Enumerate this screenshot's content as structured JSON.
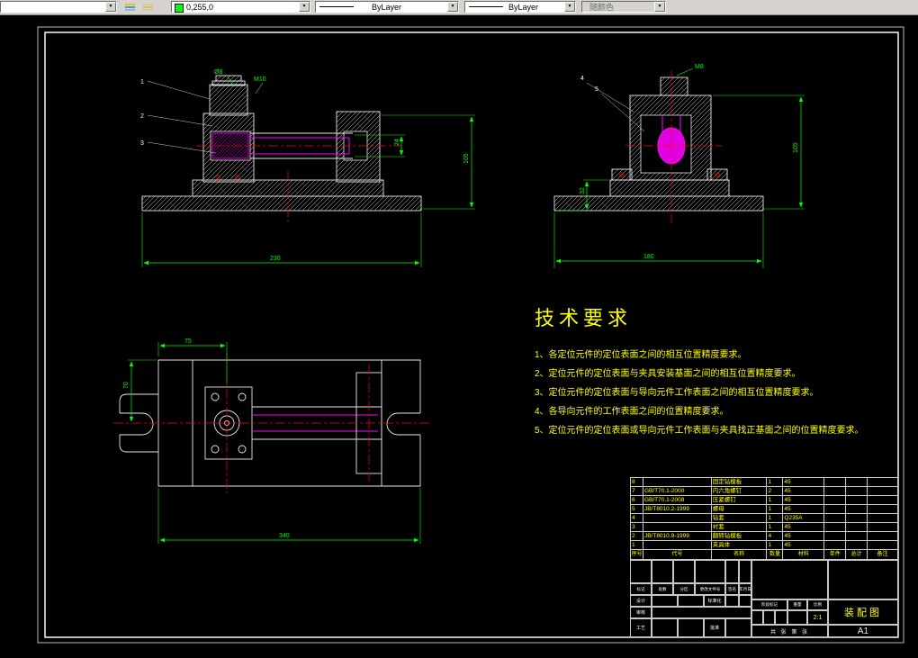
{
  "toolbar": {
    "layer_value": "",
    "color": {
      "value": "0,255,0",
      "swatch": "#00ff00"
    },
    "linetype_value": "ByLayer",
    "lineweight_value": "ByLayer",
    "plot_style_value": "随颜色"
  },
  "tech_requirements": {
    "title": "技术要求",
    "items": [
      "1、各定位元件的定位表面之间的相互位置精度要求。",
      "2、定位元件的定位表面与夹具安装基面之间的相互位置精度要求。",
      "3、定位元件的定位表面与导向元件工作表面之间的相互位置精度要求。",
      "4、各导向元件的工作表面之间的位置精度要求。",
      "5、定位元件的定位表面或导向元件工作表面与夹具找正基面之间的位置精度要求。"
    ]
  },
  "drawing": {
    "front_view": {
      "dim_width": "230",
      "dim_height": "105",
      "dim_shaft": "24",
      "label_dia": "Ø8",
      "label_thread": "M10",
      "balloons": [
        "1",
        "2",
        "3"
      ]
    },
    "side_view": {
      "dim_width": "180",
      "dim_height": "105",
      "dim_foot": "32",
      "label_thread": "M8",
      "balloons": [
        "4",
        "5"
      ]
    },
    "plan_view": {
      "dim_width": "340",
      "dim_top": "75",
      "dim_left": "70"
    }
  },
  "parts_list": {
    "header": [
      "序号",
      "代号",
      "名称",
      "数量",
      "材料",
      "单件",
      "总计",
      "备注"
    ],
    "rows": [
      {
        "no": "8",
        "code": "",
        "name": "固定钻模板",
        "qty": "1",
        "material": "45"
      },
      {
        "no": "7",
        "code": "GB/T70.1-2000",
        "name": "内六角螺钉",
        "qty": "2",
        "material": "45"
      },
      {
        "no": "6",
        "code": "GB/T70.1-2008",
        "name": "压紧螺钉",
        "qty": "1",
        "material": "45"
      },
      {
        "no": "5",
        "code": "JB/T8010.2-1999",
        "name": "螺母",
        "qty": "1",
        "material": "45"
      },
      {
        "no": "4",
        "code": "",
        "name": "钻套",
        "qty": "1",
        "material": "Q235A"
      },
      {
        "no": "3",
        "code": "",
        "name": "衬套",
        "qty": "1",
        "material": "45"
      },
      {
        "no": "2",
        "code": "JB/T8010.9-1999",
        "name": "翻转钻模板",
        "qty": "4",
        "material": "45"
      },
      {
        "no": "1",
        "code": "",
        "name": "夹具体",
        "qty": "1",
        "material": "45"
      }
    ]
  },
  "title_block": {
    "revision_header": [
      "标记",
      "处数",
      "分区",
      "更改文件号",
      "签名",
      "年月日"
    ],
    "design_label": "设计",
    "standardization_label": "标准化",
    "check_label": "审核",
    "process_label": "工艺",
    "approve_label": "批准",
    "stage_label": "阶段标记",
    "weight_label": "重量",
    "scale_label": "比例",
    "scale_value": "2:1",
    "sheet_info": "共  张  第  张",
    "drawing_name": "装配图",
    "sheet_size": "A1"
  }
}
